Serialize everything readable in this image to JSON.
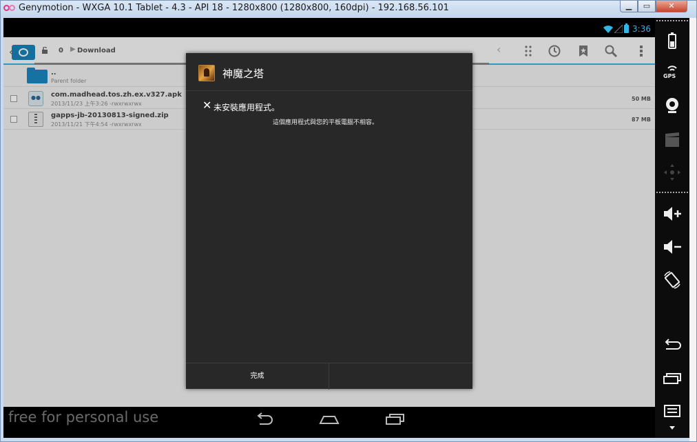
{
  "window": {
    "title": "Genymotion - WXGA 10.1 Tablet - 4.3 - API 18 - 1280x800 (1280x800, 160dpi) - 192.168.56.101",
    "minimize_glyph": "▁",
    "maximize_glyph": "▭",
    "close_glyph": "✕"
  },
  "statusbar": {
    "time": "3:36",
    "accent": "#33b5e5"
  },
  "filemanager": {
    "path_number": "0",
    "path_folder": "Download",
    "prev_glyph": "‹",
    "files": [
      {
        "name": "..",
        "meta": "Parent folder",
        "size": ""
      },
      {
        "name": "com.madhead.tos.zh.ex.v327.apk",
        "meta": "2013/11/23 上午3:26   -rwxrwxrwx",
        "size": "50 MB"
      },
      {
        "name": "gapps-jb-20130813-signed.zip",
        "meta": "2013/11/21 下午4:54   -rwxrwxrwx",
        "size": "87 MB"
      }
    ]
  },
  "dialog": {
    "title": "神魔之塔",
    "x_glyph": "✕",
    "heading": "未安裝應用程式。",
    "message": "這個應用程式與您的平板電腦不相容。",
    "done_label": "完成"
  },
  "navbar": {
    "watermark": "free for personal use"
  },
  "sidebar": {
    "gps_label": "GPS"
  }
}
